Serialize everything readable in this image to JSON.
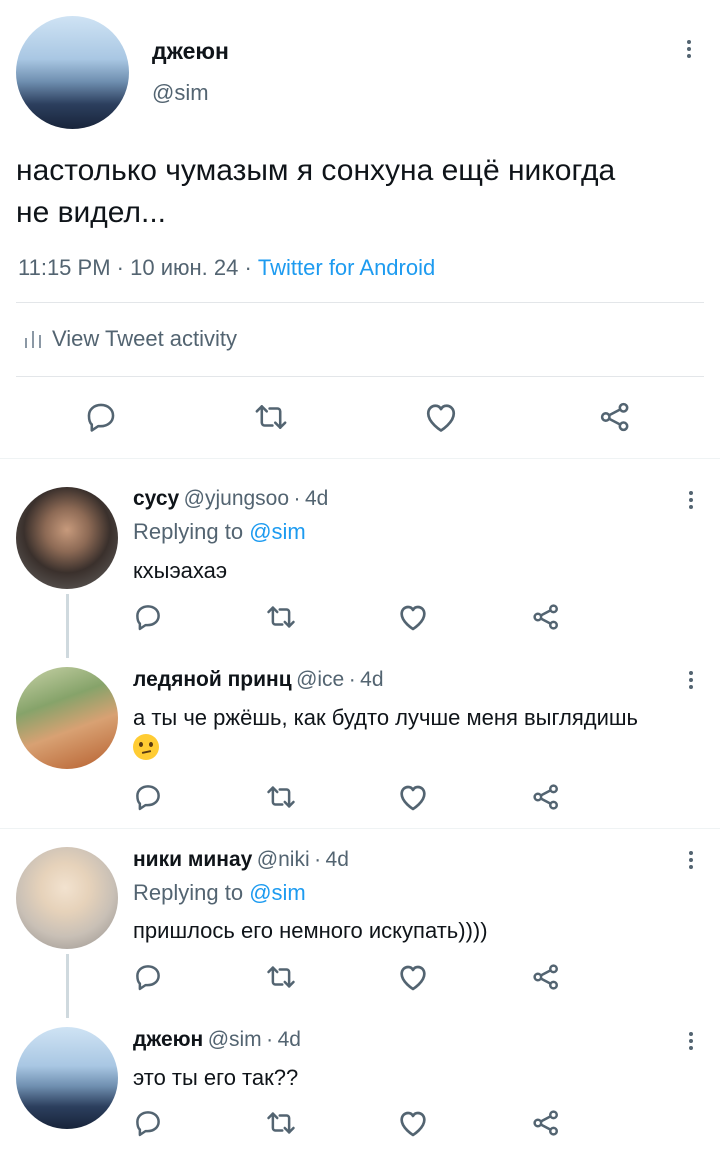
{
  "tweet": {
    "name": "джеюн",
    "handle": "@sim",
    "text": "настолько чумазым я сонхуна ещё никогда не видел...",
    "time": "11:15 PM",
    "date": "10 июн. 24",
    "source": "Twitter for Android",
    "activity_label": "View Tweet activity"
  },
  "replies": [
    {
      "name": "сусу",
      "handle": "@yjungsoo",
      "age": "4d",
      "replying_prefix": "Replying to",
      "replying_to": "@sim",
      "text": "кхыэахаэ"
    },
    {
      "name": "ледяной принц",
      "handle": "@ice",
      "age": "4d",
      "text": "а ты че ржёшь, как будто лучше меня выглядишь"
    },
    {
      "name": "ники минау",
      "handle": "@niki",
      "age": "4d",
      "replying_prefix": "Replying to",
      "replying_to": "@sim",
      "text": "пришлось его немного искупать))))"
    },
    {
      "name": "джеюн",
      "handle": "@sim",
      "age": "4d",
      "text": "это ты его так??"
    }
  ],
  "separator": "·",
  "icons": [
    "reply-icon",
    "retweet-icon",
    "like-icon",
    "share-icon",
    "more-icon",
    "activity-icon",
    "rolling-eyes-emoji"
  ],
  "colors": {
    "accent": "#1d9bf0",
    "text": "#0f1419",
    "secondary": "#536471",
    "divider": "#e3e6e9"
  }
}
